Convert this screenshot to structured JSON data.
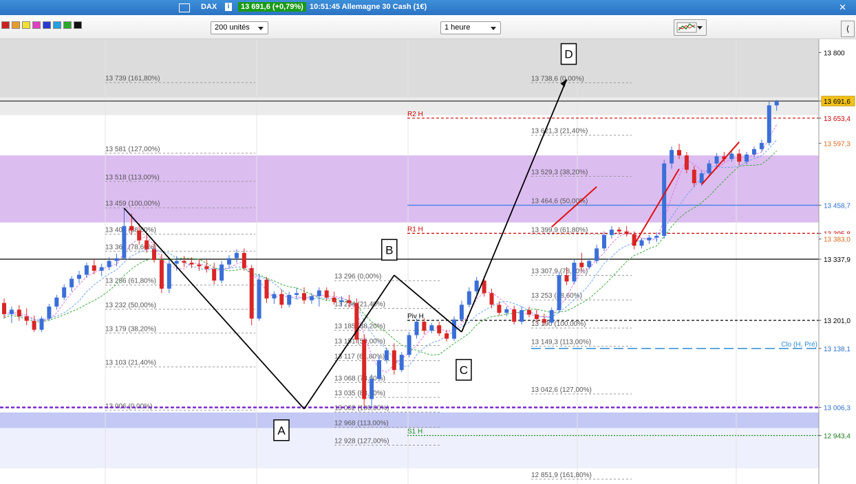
{
  "titlebar": {
    "symbol": "DAX",
    "price_change": "13 691,6 (+0,79%)",
    "description": "10:51:45 Allemagne 30 Cash (1€)",
    "info": "i",
    "close": "✕"
  },
  "toolbar": {
    "units_select": "200 unités",
    "period_select": "1 heure",
    "side_button": "⟨"
  },
  "colors": {
    "up_candle": "#3b6fd8",
    "down_candle": "#d92626",
    "purple_zone": "#dcbdf0",
    "blue_zone": "#c4c8f5",
    "title_bar": "#2b73c4",
    "price_tag": "#f3c21a"
  },
  "chart_data": {
    "type": "candlestick",
    "instrument": "Allemagne 30 Cash (1€)",
    "timeframe": "1 heure",
    "ylim": [
      12835,
      13830
    ],
    "y_ticks": [
      {
        "label": "13 800",
        "value": 13800,
        "style": "plain"
      },
      {
        "label": "13 691,6",
        "value": 13691.6,
        "style": "current"
      },
      {
        "label": "13 653,4",
        "value": 13653.4,
        "style": "red"
      },
      {
        "label": "13 597,3",
        "value": 13597.3,
        "style": "orange"
      },
      {
        "label": "13 458,7",
        "value": 13458.7,
        "style": "blue"
      },
      {
        "label": "13 395,8",
        "value": 13395.8,
        "style": "red"
      },
      {
        "label": "13 383,0",
        "value": 13383.0,
        "style": "orange"
      },
      {
        "label": "13 337,9",
        "value": 13337.9,
        "style": "plain"
      },
      {
        "label": "13 201,0",
        "value": 13201.0,
        "style": "plain"
      },
      {
        "label": "13 138,1",
        "value": 13138.1,
        "style": "blue"
      },
      {
        "label": "13 006,3",
        "value": 13006.3,
        "style": "blue"
      },
      {
        "label": "12 943,4",
        "value": 12943.4,
        "style": "green"
      }
    ],
    "zones": [
      {
        "from": 13700,
        "to": 13830,
        "color": "#dcdcdc"
      },
      {
        "from": 13660,
        "to": 13700,
        "color": "#ebebeb"
      },
      {
        "from": 13420,
        "to": 13570,
        "color": "#dcbdf0"
      },
      {
        "from": 12960,
        "to": 12995,
        "color": "#c4c8f5"
      },
      {
        "from": 12870,
        "to": 12960,
        "color": "#eef0fd"
      }
    ],
    "pivots": [
      {
        "label": "R2 H",
        "value": 13653.4,
        "color": "#cc0000"
      },
      {
        "label": "R1 H",
        "value": 13395.8,
        "color": "#cc0000"
      },
      {
        "label": "Piv H",
        "value": 13201.0,
        "color": "#000000"
      },
      {
        "label": "S1 H",
        "value": 12943.4,
        "color": "#1a8a1a"
      },
      {
        "label": "Clo (H, Pré)",
        "value": 13138.1,
        "color": "#2b8ad8"
      }
    ],
    "wave_points": [
      {
        "label": "A",
        "value": 13003,
        "bar": 40
      },
      {
        "label": "B",
        "value": 13302,
        "bar": 52
      },
      {
        "label": "C",
        "value": 13175,
        "bar": 61
      },
      {
        "label": "D",
        "value": 13740,
        "bar": 75
      }
    ],
    "fib_sets": [
      {
        "levels": [
          {
            "label": "13 739 (161,80%)",
            "value": 13739
          },
          {
            "label": "13 581 (127,00%)",
            "value": 13581
          },
          {
            "label": "13 518 (113,00%)",
            "value": 13518
          },
          {
            "label": "13 459 (100,00%)",
            "value": 13459
          },
          {
            "label": "13 400 (88,60%)",
            "value": 13400
          },
          {
            "label": "13 362 (78,60%)",
            "value": 13362
          },
          {
            "label": "13 286 (61,80%)",
            "value": 13286
          },
          {
            "label": "13 232 (50,00%)",
            "value": 13232
          },
          {
            "label": "13 179 (38,20%)",
            "value": 13179
          },
          {
            "label": "13 103 (21,40%)",
            "value": 13103
          },
          {
            "label": "13 006 (0,00%)",
            "value": 13006
          }
        ]
      },
      {
        "levels": [
          {
            "label": "13 296 (0,00%)",
            "value": 13296
          },
          {
            "label": "13 234 (21,40%)",
            "value": 13234
          },
          {
            "label": "13 185 (38,20%)",
            "value": 13185
          },
          {
            "label": "13 151 (50,00%)",
            "value": 13151
          },
          {
            "label": "13 117 (61,80%)",
            "value": 13117
          },
          {
            "label": "13 068 (78,60%)",
            "value": 13068
          },
          {
            "label": "13 035 (88,60%)",
            "value": 13035
          },
          {
            "label": "13 002 (100,00%)",
            "value": 13002
          },
          {
            "label": "12 968 (113,00%)",
            "value": 12968
          },
          {
            "label": "12 928 (127,00%)",
            "value": 12928
          }
        ]
      },
      {
        "levels": [
          {
            "label": "13 738,6 (0,00%)",
            "value": 13738.6
          },
          {
            "label": "13 621,3 (21,40%)",
            "value": 13621.3
          },
          {
            "label": "13 529,3 (38,20%)",
            "value": 13529.3
          },
          {
            "label": "13 464,6 (50,00%)",
            "value": 13464.6
          },
          {
            "label": "13 399,9 (61,80%)",
            "value": 13399.9
          },
          {
            "label": "13 307,9 (78,60%)",
            "value": 13307.9
          },
          {
            "label": "13 253 (88,60%)",
            "value": 13253
          },
          {
            "label": "13 190 (100,00%)",
            "value": 13190
          },
          {
            "label": "13 149,3 (113,00%)",
            "value": 13149.3
          },
          {
            "label": "13 042,6 (127,00%)",
            "value": 13042.6
          },
          {
            "label": "12 851,9 (161,80%)",
            "value": 12851.9
          }
        ]
      }
    ],
    "candles": [
      [
        13240,
        13250,
        13205,
        13215
      ],
      [
        13215,
        13232,
        13195,
        13225
      ],
      [
        13225,
        13235,
        13200,
        13210
      ],
      [
        13210,
        13228,
        13190,
        13200
      ],
      [
        13200,
        13212,
        13175,
        13180
      ],
      [
        13180,
        13210,
        13175,
        13205
      ],
      [
        13205,
        13238,
        13200,
        13232
      ],
      [
        13232,
        13258,
        13225,
        13252
      ],
      [
        13252,
        13282,
        13246,
        13275
      ],
      [
        13275,
        13300,
        13266,
        13294
      ],
      [
        13294,
        13312,
        13284,
        13303
      ],
      [
        13303,
        13330,
        13296,
        13324
      ],
      [
        13324,
        13338,
        13304,
        13312
      ],
      [
        13312,
        13328,
        13300,
        13320
      ],
      [
        13320,
        13342,
        13313,
        13334
      ],
      [
        13334,
        13350,
        13322,
        13340
      ],
      [
        13340,
        13452,
        13336,
        13412
      ],
      [
        13412,
        13440,
        13392,
        13402
      ],
      [
        13402,
        13418,
        13370,
        13380
      ],
      [
        13380,
        13395,
        13352,
        13360
      ],
      [
        13360,
        13378,
        13330,
        13336
      ],
      [
        13336,
        13350,
        13262,
        13272
      ],
      [
        13272,
        13338,
        13262,
        13328
      ],
      [
        13328,
        13345,
        13312,
        13334
      ],
      [
        13334,
        13345,
        13320,
        13330
      ],
      [
        13330,
        13342,
        13318,
        13326
      ],
      [
        13326,
        13338,
        13312,
        13322
      ],
      [
        13322,
        13336,
        13308,
        13316
      ],
      [
        13316,
        13330,
        13282,
        13290
      ],
      [
        13290,
        13334,
        13284,
        13326
      ],
      [
        13326,
        13347,
        13318,
        13340
      ],
      [
        13340,
        13360,
        13330,
        13352
      ],
      [
        13352,
        13362,
        13312,
        13318
      ],
      [
        13318,
        13325,
        13190,
        13205
      ],
      [
        13205,
        13305,
        13200,
        13292
      ],
      [
        13292,
        13298,
        13240,
        13250
      ],
      [
        13250,
        13266,
        13238,
        13260
      ],
      [
        13260,
        13270,
        13228,
        13236
      ],
      [
        13236,
        13265,
        13230,
        13258
      ],
      [
        13258,
        13274,
        13248,
        13262
      ],
      [
        13262,
        13275,
        13238,
        13246
      ],
      [
        13246,
        13262,
        13238,
        13255
      ],
      [
        13255,
        13275,
        13232,
        13268
      ],
      [
        13268,
        13275,
        13246,
        13252
      ],
      [
        13252,
        13265,
        13236,
        13242
      ],
      [
        13242,
        13255,
        13232,
        13246
      ],
      [
        13246,
        13258,
        13230,
        13240
      ],
      [
        13240,
        13250,
        13150,
        13158
      ],
      [
        13158,
        13170,
        13010,
        13025
      ],
      [
        13025,
        13080,
        13005,
        13070
      ],
      [
        13070,
        13120,
        13064,
        13112
      ],
      [
        13112,
        13140,
        13105,
        13134
      ],
      [
        13134,
        13150,
        13080,
        13090
      ],
      [
        13090,
        13130,
        13085,
        13124
      ],
      [
        13124,
        13175,
        13118,
        13168
      ],
      [
        13168,
        13205,
        13160,
        13198
      ],
      [
        13198,
        13206,
        13170,
        13178
      ],
      [
        13178,
        13195,
        13172,
        13190
      ],
      [
        13190,
        13198,
        13166,
        13172
      ],
      [
        13172,
        13180,
        13154,
        13160
      ],
      [
        13160,
        13210,
        13155,
        13203
      ],
      [
        13203,
        13245,
        13198,
        13236
      ],
      [
        13236,
        13275,
        13230,
        13266
      ],
      [
        13266,
        13298,
        13260,
        13290
      ],
      [
        13290,
        13300,
        13254,
        13262
      ],
      [
        13262,
        13272,
        13228,
        13236
      ],
      [
        13236,
        13244,
        13212,
        13218
      ],
      [
        13218,
        13232,
        13210,
        13226
      ],
      [
        13226,
        13234,
        13192,
        13198
      ],
      [
        13198,
        13232,
        13192,
        13224
      ],
      [
        13224,
        13232,
        13208,
        13214
      ],
      [
        13214,
        13226,
        13196,
        13204
      ],
      [
        13204,
        13216,
        13190,
        13196
      ],
      [
        13196,
        13230,
        13192,
        13224
      ],
      [
        13224,
        13310,
        13218,
        13302
      ],
      [
        13302,
        13320,
        13280,
        13288
      ],
      [
        13288,
        13338,
        13282,
        13330
      ],
      [
        13330,
        13352,
        13312,
        13320
      ],
      [
        13320,
        13340,
        13315,
        13334
      ],
      [
        13334,
        13370,
        13328,
        13362
      ],
      [
        13362,
        13400,
        13356,
        13392
      ],
      [
        13392,
        13412,
        13384,
        13404
      ],
      [
        13404,
        13410,
        13394,
        13400
      ],
      [
        13400,
        13412,
        13388,
        13394
      ],
      [
        13394,
        13400,
        13360,
        13368
      ],
      [
        13368,
        13385,
        13362,
        13380
      ],
      [
        13380,
        13392,
        13372,
        13386
      ],
      [
        13386,
        13398,
        13376,
        13390
      ],
      [
        13390,
        13560,
        13384,
        13552
      ],
      [
        13552,
        13590,
        13540,
        13582
      ],
      [
        13582,
        13596,
        13562,
        13570
      ],
      [
        13570,
        13578,
        13530,
        13538
      ],
      [
        13538,
        13546,
        13500,
        13508
      ],
      [
        13508,
        13536,
        13502,
        13530
      ],
      [
        13530,
        13560,
        13524,
        13552
      ],
      [
        13552,
        13575,
        13546,
        13568
      ],
      [
        13568,
        13578,
        13556,
        13562
      ],
      [
        13562,
        13580,
        13556,
        13574
      ],
      [
        13574,
        13584,
        13548,
        13556
      ],
      [
        13556,
        13578,
        13550,
        13572
      ],
      [
        13572,
        13590,
        13566,
        13584
      ],
      [
        13584,
        13605,
        13578,
        13598
      ],
      [
        13598,
        13690,
        13592,
        13682
      ],
      [
        13682,
        13694,
        13670,
        13691.6
      ]
    ]
  }
}
